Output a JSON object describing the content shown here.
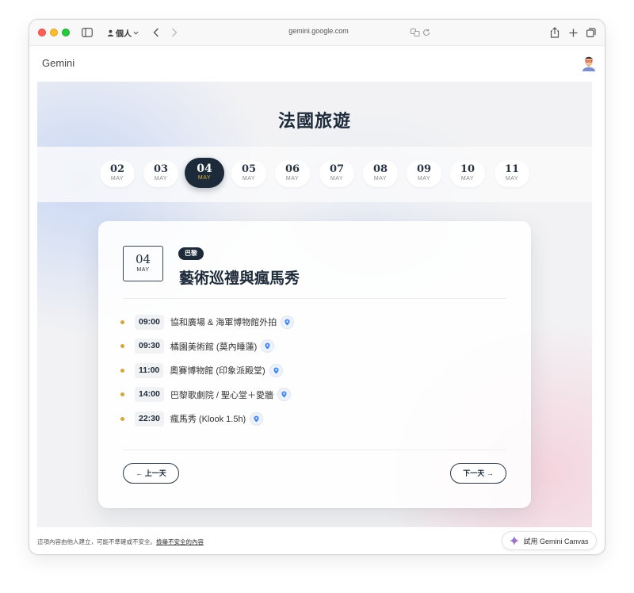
{
  "browser": {
    "profile_label": "個人",
    "url": "gemini.google.com"
  },
  "app": {
    "title": "Gemini"
  },
  "trip": {
    "title": "法國旅遊",
    "days": [
      {
        "num": "02",
        "month": "MAY",
        "active": false
      },
      {
        "num": "03",
        "month": "MAY",
        "active": false
      },
      {
        "num": "04",
        "month": "MAY",
        "active": true
      },
      {
        "num": "05",
        "month": "MAY",
        "active": false
      },
      {
        "num": "06",
        "month": "MAY",
        "active": false
      },
      {
        "num": "07",
        "month": "MAY",
        "active": false
      },
      {
        "num": "08",
        "month": "MAY",
        "active": false
      },
      {
        "num": "09",
        "month": "MAY",
        "active": false
      },
      {
        "num": "10",
        "month": "MAY",
        "active": false
      },
      {
        "num": "11",
        "month": "MAY",
        "active": false
      }
    ]
  },
  "day_card": {
    "date_num": "04",
    "date_month": "MAY",
    "city": "巴黎",
    "title": "藝術巡禮與瘋馬秀",
    "schedule": [
      {
        "time": "09:00",
        "activity": "協和廣場 & 海軍博物館外拍"
      },
      {
        "time": "09:30",
        "activity": "橘園美術館 (莫內睡蓮)"
      },
      {
        "time": "11:00",
        "activity": "奧賽博物館 (印象派殿堂)"
      },
      {
        "time": "14:00",
        "activity": "巴黎歌劇院 / 聖心堂＋愛牆"
      },
      {
        "time": "22:30",
        "activity": "瘋馬秀 (Klook 1.5h)"
      }
    ],
    "prev_label": "← 上一天",
    "next_label": "下一天 →"
  },
  "footer": {
    "disclaimer_text": "這項內容由他人建立，可能不準確或不安全。",
    "report_link": "檢舉不安全的內容",
    "canvas_button": "試用 Gemini Canvas"
  },
  "colors": {
    "navy": "#1c2a3a",
    "gold": "#d4a63c",
    "pin_blue": "#4285f4"
  }
}
